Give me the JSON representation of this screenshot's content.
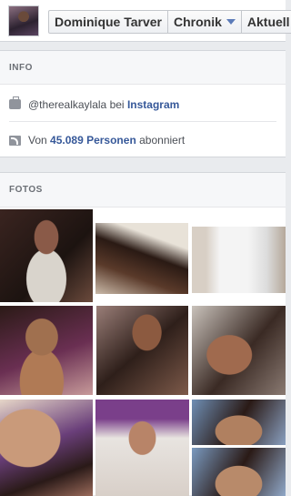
{
  "header": {
    "tabs": [
      {
        "label": "Dominique Tarver"
      },
      {
        "label": "Chronik"
      },
      {
        "label": "Aktuell"
      }
    ]
  },
  "info": {
    "title": "INFO",
    "instagram": {
      "handle": "@therealkaylala",
      "mid": "bei",
      "link": "Instagram"
    },
    "followers": {
      "prefix": "Von",
      "count": "45.089 Personen",
      "suffix": "abonniert"
    }
  },
  "photos": {
    "title": "FOTOS"
  },
  "colors": {
    "link": "#365899",
    "caret": "#5b7bb8",
    "background": "#e9ebee"
  }
}
